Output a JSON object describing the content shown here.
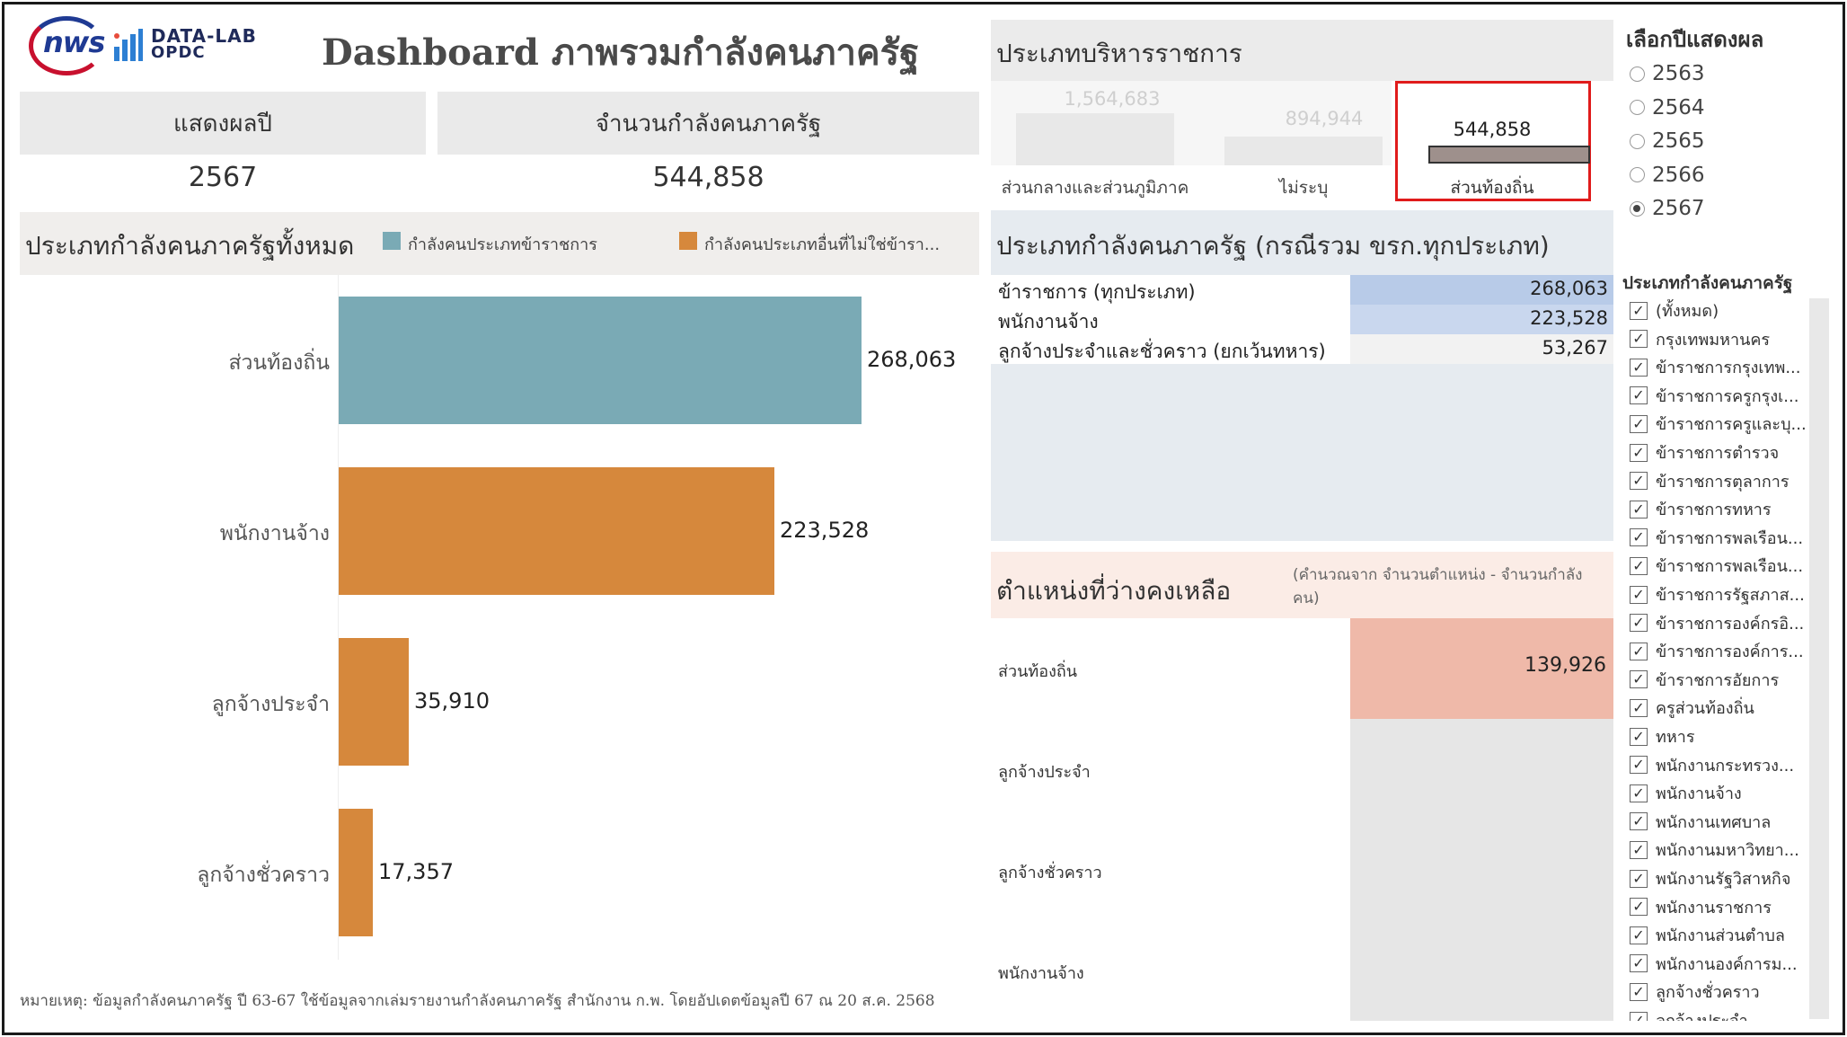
{
  "header": {
    "logo_text": "nws",
    "datalab_line1": "DATA-LAB",
    "datalab_line2": "OPDC",
    "title": "Dashboard ภาพรวมกำลังคนภาครัฐ"
  },
  "kpis": {
    "year_label": "แสดงผลปี",
    "year_value": "2567",
    "total_label": "จำนวนกำลังคนภาครัฐ",
    "total_value": "544,858"
  },
  "left_chart": {
    "title": "ประเภทกำลังคนภาครัฐทั้งหมด",
    "legend": [
      {
        "label": "กำลังคนประเภทข้าราชการ",
        "color": "#7aaab5"
      },
      {
        "label": "กำลังคนประเภทอื่นที่ไม่ใช่ข้ารา...",
        "color": "#d6883c"
      }
    ],
    "bars": [
      {
        "label": "ส่วนท้องถิ่น",
        "display": "268,063",
        "color": "#7aaab5"
      },
      {
        "label": "พนักงานจ้าง",
        "display": "223,528",
        "color": "#d6883c"
      },
      {
        "label": "ลูกจ้างประจำ",
        "display": "35,910",
        "color": "#d6883c"
      },
      {
        "label": "ลูกจ้างชั่วคราว",
        "display": "17,357",
        "color": "#d6883c"
      }
    ]
  },
  "chart_data": {
    "type": "bar",
    "orientation": "horizontal",
    "title": "ประเภทกำลังคนภาครัฐทั้งหมด",
    "categories": [
      "ส่วนท้องถิ่น",
      "พนักงานจ้าง",
      "ลูกจ้างประจำ",
      "ลูกจ้างชั่วคราว"
    ],
    "values": [
      268063,
      223528,
      35910,
      17357
    ],
    "legend": [
      "กำลังคนประเภทข้าราชการ",
      "กำลังคนประเภทอื่นที่ไม่ใช่ข้ารา..."
    ],
    "legend_position": "top"
  },
  "note": "หมายเหตุ: ข้อมูลกำลังคนภาครัฐ ปี 63-67 ใช้ข้อมูลจากเล่มรายงานกำลังคนภาครัฐ สำนักงาน ก.พ. โดยอัปเดตข้อมูลปี 67 ณ 20 ส.ค. 2568",
  "admin_type": {
    "title": "ประเภทบริหารราชการ",
    "items": [
      {
        "label": "ส่วนกลางและส่วนภูมิภาค",
        "value": "1,564,683",
        "selected": false
      },
      {
        "label": "ไม่ระบุ",
        "value": "894,944",
        "selected": false
      },
      {
        "label": "ส่วนท้องถิ่น",
        "value": "544,858",
        "selected": true
      }
    ]
  },
  "workforce_table": {
    "title": "ประเภทกำลังคนภาครัฐ (กรณีรวม ขรก.ทุกประเภท)",
    "rows": [
      {
        "name": "ข้าราชการ (ทุกประเภท)",
        "value": "268,063"
      },
      {
        "name": "พนักงานจ้าง",
        "value": "223,528"
      },
      {
        "name": "ลูกจ้างประจำและชั่วคราว (ยกเว้นทหาร)",
        "value": "53,267"
      }
    ]
  },
  "vacancy": {
    "title": "ตำแหน่งที่ว่างคงเหลือ",
    "subtitle_line1": "(คำนวณจาก จำนวนตำแหน่ง - จำนวนกำลัง",
    "subtitle_line2": "คน)",
    "rows": [
      {
        "name": "ส่วนท้องถิ่น",
        "value": "139,926"
      },
      {
        "name": "ลูกจ้างประจำ",
        "value": ""
      },
      {
        "name": "ลูกจ้างชั่วคราว",
        "value": ""
      },
      {
        "name": "พนักงานจ้าง",
        "value": ""
      }
    ]
  },
  "year_filter": {
    "title": "เลือกปีแสดงผล",
    "options": [
      "2563",
      "2564",
      "2565",
      "2566",
      "2567"
    ],
    "selected": "2567"
  },
  "type_filter": {
    "title": "ประเภทกำลังคนภาครัฐ",
    "options": [
      "(ทั้งหมด)",
      "กรุงเทพมหานคร",
      "ข้าราชการกรุงเทพ...",
      "ข้าราชการครูกรุงเ...",
      "ข้าราชการครูและบุ...",
      "ข้าราชการตำรวจ",
      "ข้าราชการตุลาการ",
      "ข้าราชการทหาร",
      "ข้าราชการพลเรือน...",
      "ข้าราชการพลเรือน...",
      "ข้าราชการรัฐสภาส...",
      "ข้าราชการองค์กรอิ...",
      "ข้าราชการองค์การ...",
      "ข้าราชการอัยการ",
      "ครูส่วนท้องถิ่น",
      "ทหาร",
      "พนักงานกระทรวง...",
      "พนักงานจ้าง",
      "พนักงานเทศบาล",
      "พนักงานมหาวิทยา...",
      "พนักงานรัฐวิสาหกิจ",
      "พนักงานราชการ",
      "พนักงานส่วนตำบล",
      "พนักงานองค์การม...",
      "ลูกจ้างชั่วคราว",
      "ลูกจ้างประจำ"
    ],
    "check_glyph": "✓"
  }
}
